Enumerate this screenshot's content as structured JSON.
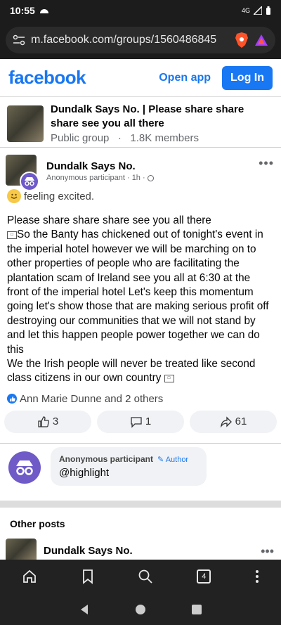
{
  "status": {
    "time": "10:55",
    "network": "4G"
  },
  "browser": {
    "url": "m.facebook.com/groups/1560486845",
    "tab_count": "4"
  },
  "fb_header": {
    "logo": "facebook",
    "open_app": "Open app",
    "login": "Log In"
  },
  "group": {
    "name": "Dundalk Says No. | Please share share share see you all there",
    "privacy": "Public group",
    "separator": "·",
    "members": "1.8K members"
  },
  "post": {
    "group_name": "Dundalk Says No.",
    "author": "Anonymous participant",
    "time": "· 1h ·",
    "feeling": "feeling excited.",
    "body_lines": [
      "Please share share share see you all there",
      "So the Banty  has chickened out of tonight's event in the imperial hotel however we will be marching on to other properties of people who are facilitating the plantation scam  of Ireland  see you all at 6:30 at the front of the imperial hotel   Let's keep this momentum going  let's show those that are making serious profit off  destroying our communities that we will not stand by and let  this happen people power together we can do this",
      "We the Irish people will never be treated like second class citizens in our  own country"
    ],
    "reactions_text": "Ann Marie Dunne and 2 others",
    "likes": "3",
    "comments": "1",
    "shares": "61"
  },
  "comment": {
    "author": "Anonymous participant",
    "author_tag": "Author",
    "text": "@highlight"
  },
  "other_posts": {
    "heading": "Other posts",
    "next_post_name": "Dundalk Says No."
  },
  "colors": {
    "brand": "#1877f2",
    "anon_avatar": "#6f5ac8"
  }
}
